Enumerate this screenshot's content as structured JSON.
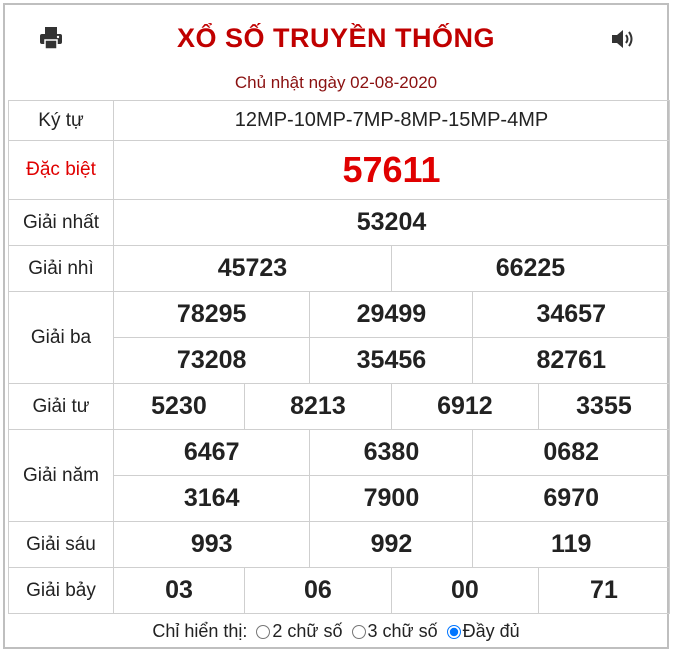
{
  "header": {
    "title": "XỔ SỐ TRUYỀN THỐNG",
    "date": "Chủ nhật ngày 02-08-2020"
  },
  "rows": {
    "serial": {
      "label": "Ký tự",
      "value": "12MP-10MP-7MP-8MP-15MP-4MP"
    },
    "special": {
      "label": "Đặc biệt",
      "value": "57611"
    },
    "first": {
      "label": "Giải nhất",
      "values": [
        "53204"
      ]
    },
    "second": {
      "label": "Giải nhì",
      "values": [
        "45723",
        "66225"
      ]
    },
    "third": {
      "label": "Giải ba",
      "values": [
        "78295",
        "29499",
        "34657",
        "73208",
        "35456",
        "82761"
      ]
    },
    "fourth": {
      "label": "Giải tư",
      "values": [
        "5230",
        "8213",
        "6912",
        "3355"
      ]
    },
    "fifth": {
      "label": "Giải năm",
      "values": [
        "6467",
        "6380",
        "0682",
        "3164",
        "7900",
        "6970"
      ]
    },
    "sixth": {
      "label": "Giải sáu",
      "values": [
        "993",
        "992",
        "119"
      ]
    },
    "seventh": {
      "label": "Giải bảy",
      "values": [
        "03",
        "06",
        "00",
        "71"
      ]
    }
  },
  "footer": {
    "prefix": "Chỉ hiển thị:",
    "options": [
      "2 chữ số",
      "3 chữ số",
      "Đầy đủ"
    ],
    "selected": "Đầy đủ"
  },
  "icons": {
    "print": "printer-icon",
    "sound": "speaker-icon"
  },
  "colors": {
    "title": "#c00000",
    "special": "#e00000",
    "date": "#8a1010"
  }
}
